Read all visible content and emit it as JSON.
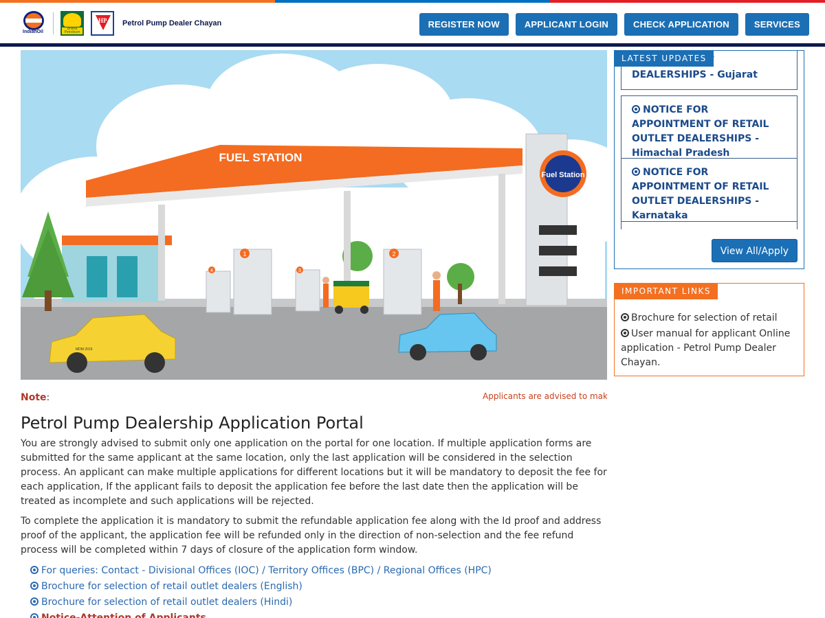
{
  "header": {
    "logos": {
      "indianoil": "IndianOil",
      "bharat": "Bharat Petroleum",
      "hp": "HP"
    },
    "brand": "Petrol Pump Dealer Chayan",
    "nav": [
      {
        "label": "REGISTER NOW"
      },
      {
        "label": "APPLICANT LOGIN"
      },
      {
        "label": "CHECK APPLICATION"
      },
      {
        "label": "SERVICES"
      }
    ],
    "colors": {
      "strip": [
        "#f37021",
        "#0070c0",
        "#e31e24"
      ],
      "nav": "#1b6fb5",
      "bar": "#0d1a4d"
    }
  },
  "hero": {
    "canopy_text": "FUEL STATION",
    "pylon_text": "Fuel Station",
    "pump_numbers": [
      "1",
      "2",
      "3",
      "4"
    ],
    "plate_text": "MDM 2019"
  },
  "note": {
    "label": "Note",
    "colon": ":",
    "marquee": "Applicants are advised to make a"
  },
  "main": {
    "title": "Petrol Pump Dealership Application Portal",
    "paragraphs": [
      "You are strongly advised to submit only one application on the portal for one location. If multiple application forms are submitted for the same applicant at the same location, only the last application will be considered in the selection process. An applicant can make multiple applications for different locations but it will be mandatory to deposit the fee for each application, If the applicant fails to deposit the application fee before the last date then the application will be treated as incomplete and such applications will be rejected.",
      "To complete the application it is mandatory to submit the refundable application fee along with the Id proof and address proof of the applicant, the application fee will be refunded only in the direction of non-selection and the fee refund process will be completed within 7 days of closure of the application form window."
    ],
    "links": [
      {
        "label": "For queries: Contact - Divisional Offices (IOC) / Territory Offices (BPC) / Regional Offices (HPC)"
      },
      {
        "label": "Brochure for selection of retail outlet dealers (English)"
      },
      {
        "label": "Brochure for selection of retail outlet dealers (Hindi)"
      },
      {
        "label_red": "Notice",
        "label_rest": "-Attention of Applicants"
      }
    ]
  },
  "latest_updates": {
    "title": "LATEST UPDATES",
    "items": [
      {
        "text": "NOTICE FOR APPOINTMENT OF RETAIL OUTLET DEALERSHIPS - Gujarat",
        "visible": "RETAIL OUTLET DEALERSHIPS - Gujarat"
      },
      {
        "text": "NOTICE FOR APPOINTMENT OF RETAIL OUTLET DEALERSHIPS - Himachal Pradesh"
      },
      {
        "text": "NOTICE FOR APPOINTMENT OF RETAIL OUTLET DEALERSHIPS - Karnataka"
      }
    ],
    "view_all": "View All/Apply"
  },
  "important_links": {
    "title": "IMPORTANT LINKS",
    "items": [
      {
        "label": "Brochure for selection of retail"
      },
      {
        "label": "User manual for applicant Online application - Petrol Pump Dealer Chayan."
      }
    ]
  }
}
